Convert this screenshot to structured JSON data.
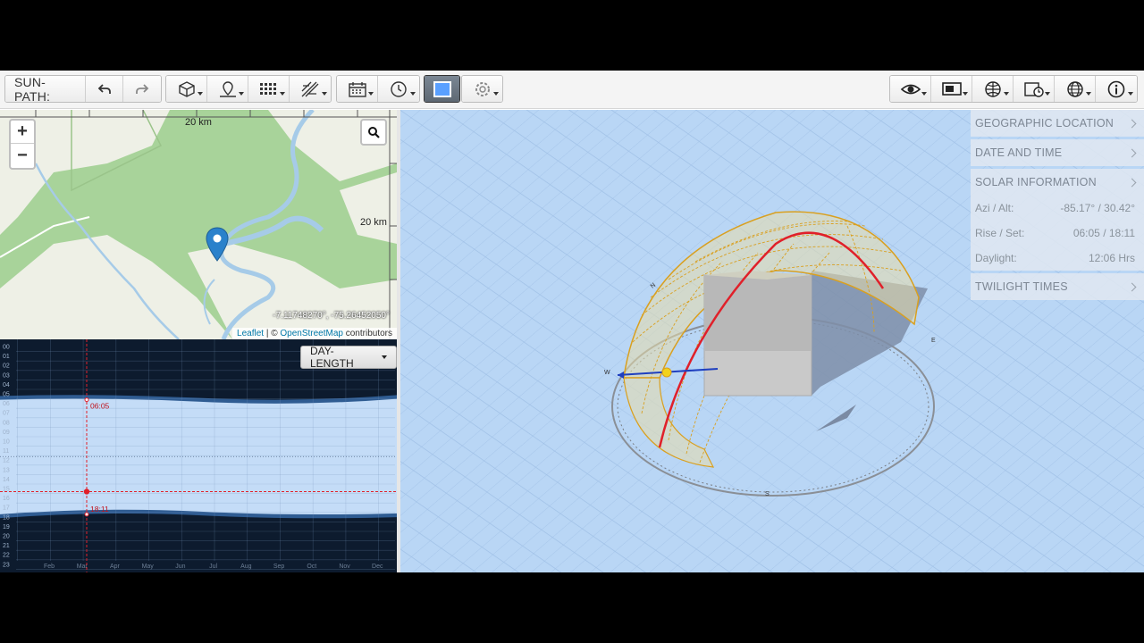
{
  "toolbar": {
    "app_label": "SUN-PATH:",
    "undo_icon": "undo-icon",
    "redo_icon": "redo-icon"
  },
  "map": {
    "zoom_in": "+",
    "zoom_out": "−",
    "scale_top": "20 km",
    "scale_right": "20 km",
    "coordinates": "-7.11748270°, -75.26452050°",
    "attribution_leaflet": "Leaflet",
    "attribution_sep": " | © ",
    "attribution_osm": "OpenStreetMap",
    "attribution_suffix": " contributors"
  },
  "day_length": {
    "dropdown_label": "DAY-LENGTH",
    "hours": [
      "00",
      "01",
      "02",
      "03",
      "04",
      "05",
      "06",
      "07",
      "08",
      "09",
      "10",
      "11",
      "12",
      "13",
      "14",
      "15",
      "16",
      "17",
      "18",
      "19",
      "20",
      "21",
      "22",
      "23"
    ],
    "months": [
      "Feb",
      "Mar",
      "Apr",
      "May",
      "Jun",
      "Jul",
      "Aug",
      "Sep",
      "Oct",
      "Nov",
      "Dec"
    ],
    "sunrise_label": "06:05",
    "sunset_label": "18:11"
  },
  "panel": {
    "geographic_location": "GEOGRAPHIC LOCATION",
    "date_and_time": "DATE AND TIME",
    "solar_information": "SOLAR INFORMATION",
    "azi_alt_label": "Azi / Alt:",
    "azi_alt_value": "-85.17° / 30.42°",
    "rise_set_label": "Rise / Set:",
    "rise_set_value": "06:05 / 18:11",
    "daylight_label": "Daylight:",
    "daylight_value": "12:06 Hrs",
    "twilight_times": "TWILIGHT TIMES"
  },
  "colors": {
    "map_land": "#a8d39a",
    "map_river": "#a6cbe8",
    "sky_3d": "#b9d6f5",
    "sunpath_red": "#e0202a",
    "sunpath_yellow": "#d9a020"
  }
}
